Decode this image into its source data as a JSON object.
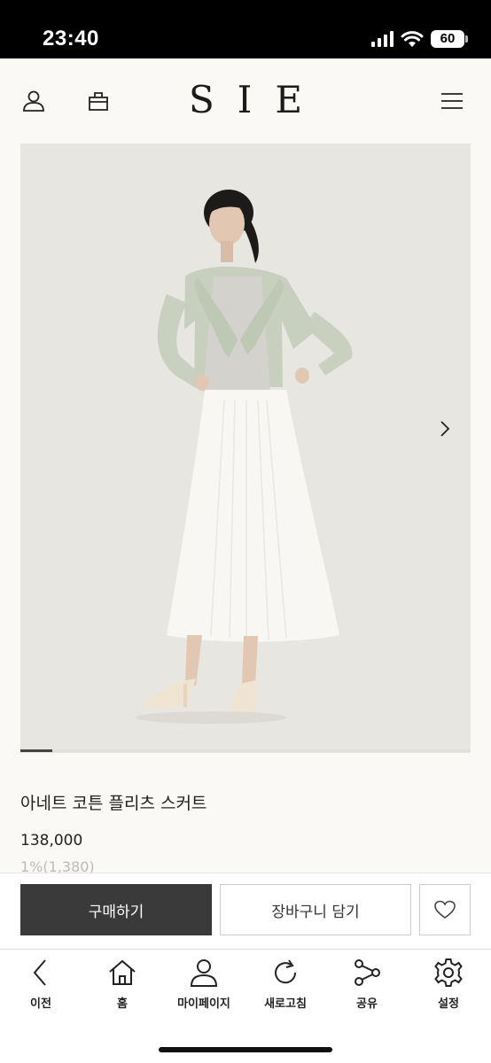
{
  "status_bar": {
    "time": "23:40",
    "battery": "60"
  },
  "header": {
    "logo": "SIE",
    "icons": [
      "user-icon",
      "bag-icon",
      "menu-icon"
    ]
  },
  "gallery": {
    "next_icon": "chevron-right-icon",
    "current_index": 1,
    "progress": 0.07
  },
  "product": {
    "name": "아네트 코튼 플리츠 스커트",
    "price": "138,000",
    "point": "1%(1,380)"
  },
  "actions": {
    "buy_label": "구매하기",
    "cart_label": "장바구니 담기",
    "wish_icon": "heart-icon"
  },
  "bottom_nav": {
    "items": [
      {
        "label": "이전",
        "icon": "back-icon"
      },
      {
        "label": "홈",
        "icon": "home-icon"
      },
      {
        "label": "마이페이지",
        "icon": "person-icon"
      },
      {
        "label": "새로고침",
        "icon": "refresh-icon"
      },
      {
        "label": "공유",
        "icon": "share-icon"
      },
      {
        "label": "설정",
        "icon": "settings-icon"
      }
    ]
  },
  "colors": {
    "buy_button": "#3a3a3a",
    "page_background": "#faf9f6",
    "photo_background": "#e8e6e0"
  }
}
